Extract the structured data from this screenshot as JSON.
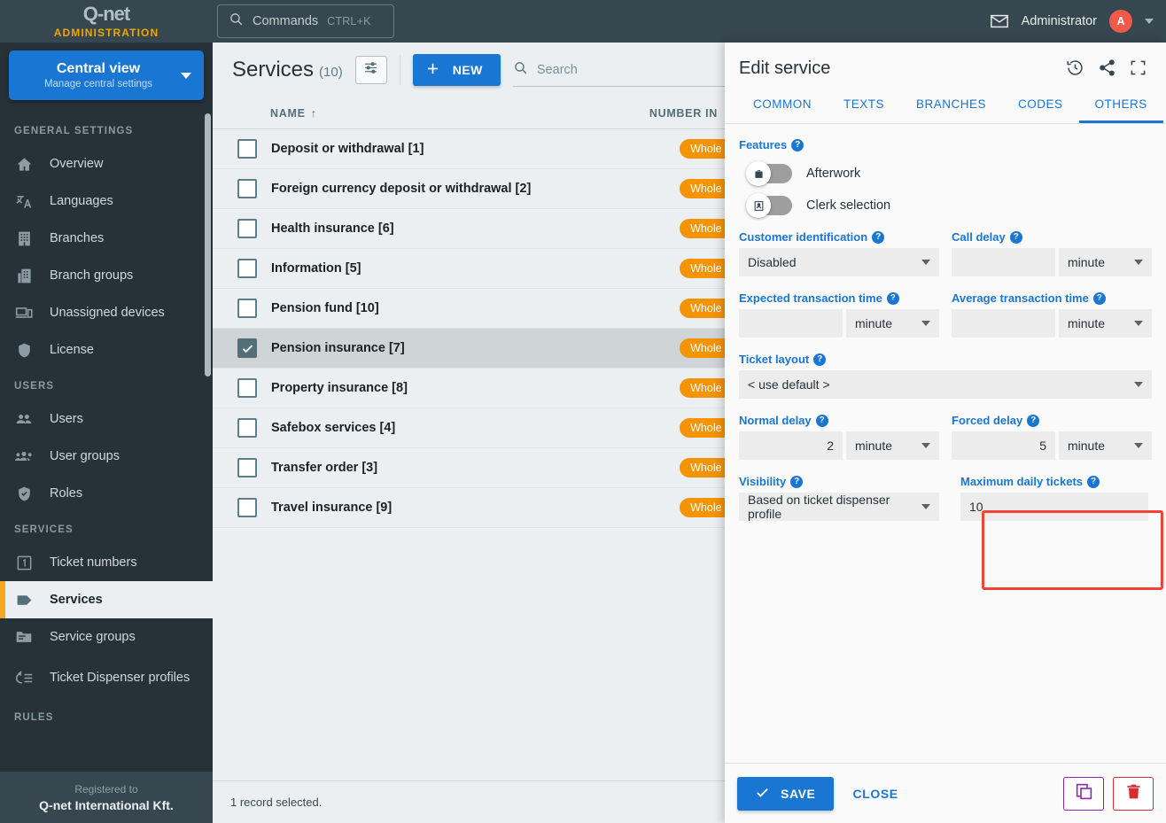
{
  "brand": {
    "logo": "Q-net",
    "sub": "ADMINISTRATION"
  },
  "topbar": {
    "commands_label": "Commands",
    "commands_shortcut": "CTRL+K",
    "mail_icon": "envelope-icon",
    "user_name": "Administrator",
    "avatar_initial": "A"
  },
  "view_selector": {
    "title": "Central view",
    "subtitle": "Manage central settings"
  },
  "sidebar": {
    "sections": [
      {
        "title": "GENERAL SETTINGS",
        "items": [
          {
            "label": "Overview",
            "icon": "home-icon",
            "active": false
          },
          {
            "label": "Languages",
            "icon": "translate-icon",
            "active": false
          },
          {
            "label": "Branches",
            "icon": "building-icon",
            "active": false
          },
          {
            "label": "Branch groups",
            "icon": "buildings-icon",
            "active": false
          },
          {
            "label": "Unassigned devices",
            "icon": "devices-icon",
            "active": false
          },
          {
            "label": "License",
            "icon": "shield-icon",
            "active": false
          }
        ]
      },
      {
        "title": "USERS",
        "items": [
          {
            "label": "Users",
            "icon": "users-icon",
            "active": false
          },
          {
            "label": "User groups",
            "icon": "user-groups-icon",
            "active": false
          },
          {
            "label": "Roles",
            "icon": "shield-check-icon",
            "active": false
          }
        ]
      },
      {
        "title": "SERVICES",
        "items": [
          {
            "label": "Ticket numbers",
            "icon": "number-one-icon",
            "active": false
          },
          {
            "label": "Services",
            "icon": "tag-icon",
            "active": true
          },
          {
            "label": "Service groups",
            "icon": "folder-icon",
            "active": false
          },
          {
            "label": "Ticket Dispenser profiles",
            "icon": "dispenser-icon",
            "active": false
          }
        ]
      },
      {
        "title": "RULES",
        "items": []
      }
    ],
    "registered_to_label": "Registered to",
    "registered_to_name": "Q-net International Kft."
  },
  "list": {
    "title": "Services",
    "count": "(10)",
    "filter_icon": "filter-sliders-icon",
    "new_button": "NEW",
    "search_placeholder": "Search",
    "columns": {
      "name": "NAME",
      "sort_arrow": "↑",
      "number": "NUMBER IN"
    },
    "rows": [
      {
        "name": "Deposit or withdrawal [1]",
        "badge": "Whole range",
        "checked": false,
        "selected": false
      },
      {
        "name": "Foreign currency deposit or withdrawal [2]",
        "badge": "Whole range",
        "checked": false,
        "selected": false
      },
      {
        "name": "Health insurance [6]",
        "badge": "Whole range",
        "checked": false,
        "selected": false
      },
      {
        "name": "Information [5]",
        "badge": "Whole range",
        "checked": false,
        "selected": false
      },
      {
        "name": "Pension fund [10]",
        "badge": "Whole range",
        "checked": false,
        "selected": false
      },
      {
        "name": "Pension insurance [7]",
        "badge": "Whole range",
        "checked": true,
        "selected": true
      },
      {
        "name": "Property insurance [8]",
        "badge": "Whole range",
        "checked": false,
        "selected": false
      },
      {
        "name": "Safebox services [4]",
        "badge": "Whole range",
        "checked": false,
        "selected": false
      },
      {
        "name": "Transfer order [3]",
        "badge": "Whole range",
        "checked": false,
        "selected": false
      },
      {
        "name": "Travel insurance [9]",
        "badge": "Whole range",
        "checked": false,
        "selected": false
      }
    ],
    "status": "1 record selected."
  },
  "panel": {
    "title": "Edit service",
    "header_icons": [
      "history-icon",
      "share-icon",
      "fullscreen-icon"
    ],
    "tabs": [
      {
        "label": "COMMON",
        "active": false
      },
      {
        "label": "TEXTS",
        "active": false
      },
      {
        "label": "BRANCHES",
        "active": false
      },
      {
        "label": "CODES",
        "active": false
      },
      {
        "label": "OTHERS",
        "active": true
      }
    ],
    "features": {
      "label": "Features",
      "toggles": [
        {
          "label": "Afterwork",
          "icon": "briefcase-icon",
          "on": false
        },
        {
          "label": "Clerk selection",
          "icon": "id-card-icon",
          "on": false
        }
      ]
    },
    "fields": {
      "customer_identification": {
        "label": "Customer identification",
        "value": "Disabled"
      },
      "call_delay": {
        "label": "Call delay",
        "value": "",
        "unit": "minute"
      },
      "expected_transaction_time": {
        "label": "Expected transaction time",
        "value": "",
        "unit": "minute"
      },
      "average_transaction_time": {
        "label": "Average transaction time",
        "value": "",
        "unit": "minute"
      },
      "ticket_layout": {
        "label": "Ticket layout",
        "value": "< use default >"
      },
      "normal_delay": {
        "label": "Normal delay",
        "value": "2",
        "unit": "minute"
      },
      "forced_delay": {
        "label": "Forced delay",
        "value": "5",
        "unit": "minute"
      },
      "visibility": {
        "label": "Visibility",
        "value": "Based on ticket dispenser profile"
      },
      "maximum_daily_tickets": {
        "label": "Maximum daily tickets",
        "value": "10"
      }
    },
    "footer": {
      "save_label": "SAVE",
      "close_label": "CLOSE",
      "copy_icon": "copy-icon",
      "delete_icon": "trash-icon"
    }
  },
  "colors": {
    "accent_blue": "#1976d2",
    "sidebar_dark": "#263238",
    "topbar_dark": "#37474f",
    "badge_orange": "#f59300",
    "highlight_red": "#f04438",
    "active_marker": "#f5a623",
    "avatar_red": "#f05a4b"
  }
}
